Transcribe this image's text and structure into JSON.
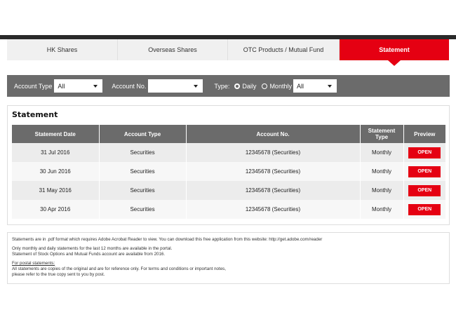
{
  "tabs": [
    {
      "label": "HK Shares",
      "active": false
    },
    {
      "label": "Overseas Shares",
      "active": false
    },
    {
      "label": "OTC Products / Mutual Fund",
      "active": false
    },
    {
      "label": "Statement",
      "active": true
    }
  ],
  "filter": {
    "account_type_label": "Account Type",
    "account_type_value": "All",
    "account_no_label": "Account No.",
    "account_no_value": "",
    "type_label": "Type:",
    "daily_label": "Daily",
    "monthly_label": "Monthly",
    "selected_type": "Daily",
    "period_value": "All"
  },
  "statement": {
    "title": "Statement",
    "headers": [
      "Statement Date",
      "Account Type",
      "Account No.",
      "Statement Type",
      "Preview"
    ],
    "rows": [
      {
        "date": "31 Jul 2016",
        "account_type": "Securities",
        "account_no": "12345678 (Securities)",
        "statement_type": "Monthly",
        "action": "OPEN"
      },
      {
        "date": "30 Jun 2016",
        "account_type": "Securities",
        "account_no": "12345678 (Securities)",
        "statement_type": "Monthly",
        "action": "OPEN"
      },
      {
        "date": "31 May 2016",
        "account_type": "Securities",
        "account_no": "12345678 (Securities)",
        "statement_type": "Monthly",
        "action": "OPEN"
      },
      {
        "date": "30 Apr 2016",
        "account_type": "Securities",
        "account_no": "12345678 (Securities)",
        "statement_type": "Monthly",
        "action": "OPEN"
      }
    ]
  },
  "notes": {
    "line1": "Statements are in .pdf format which requires Adobe Acrobat Reader to view. You can download this free application from this website: http://get.adobe.com/reader",
    "line2": "Only monthly and daily statements for the last 12 months are available in the portal.",
    "line3": "Statement of Stock Options and Mutual Funds account are available from 2016.",
    "postal_heading": "For postal statements:",
    "line4": "All statements are copies of the original and are for reference only. For terms and conditions or important notes,",
    "line5": "please refer to the true copy sent to you by post."
  },
  "colors": {
    "accent": "#e50012",
    "bar": "#6b6b6b"
  }
}
